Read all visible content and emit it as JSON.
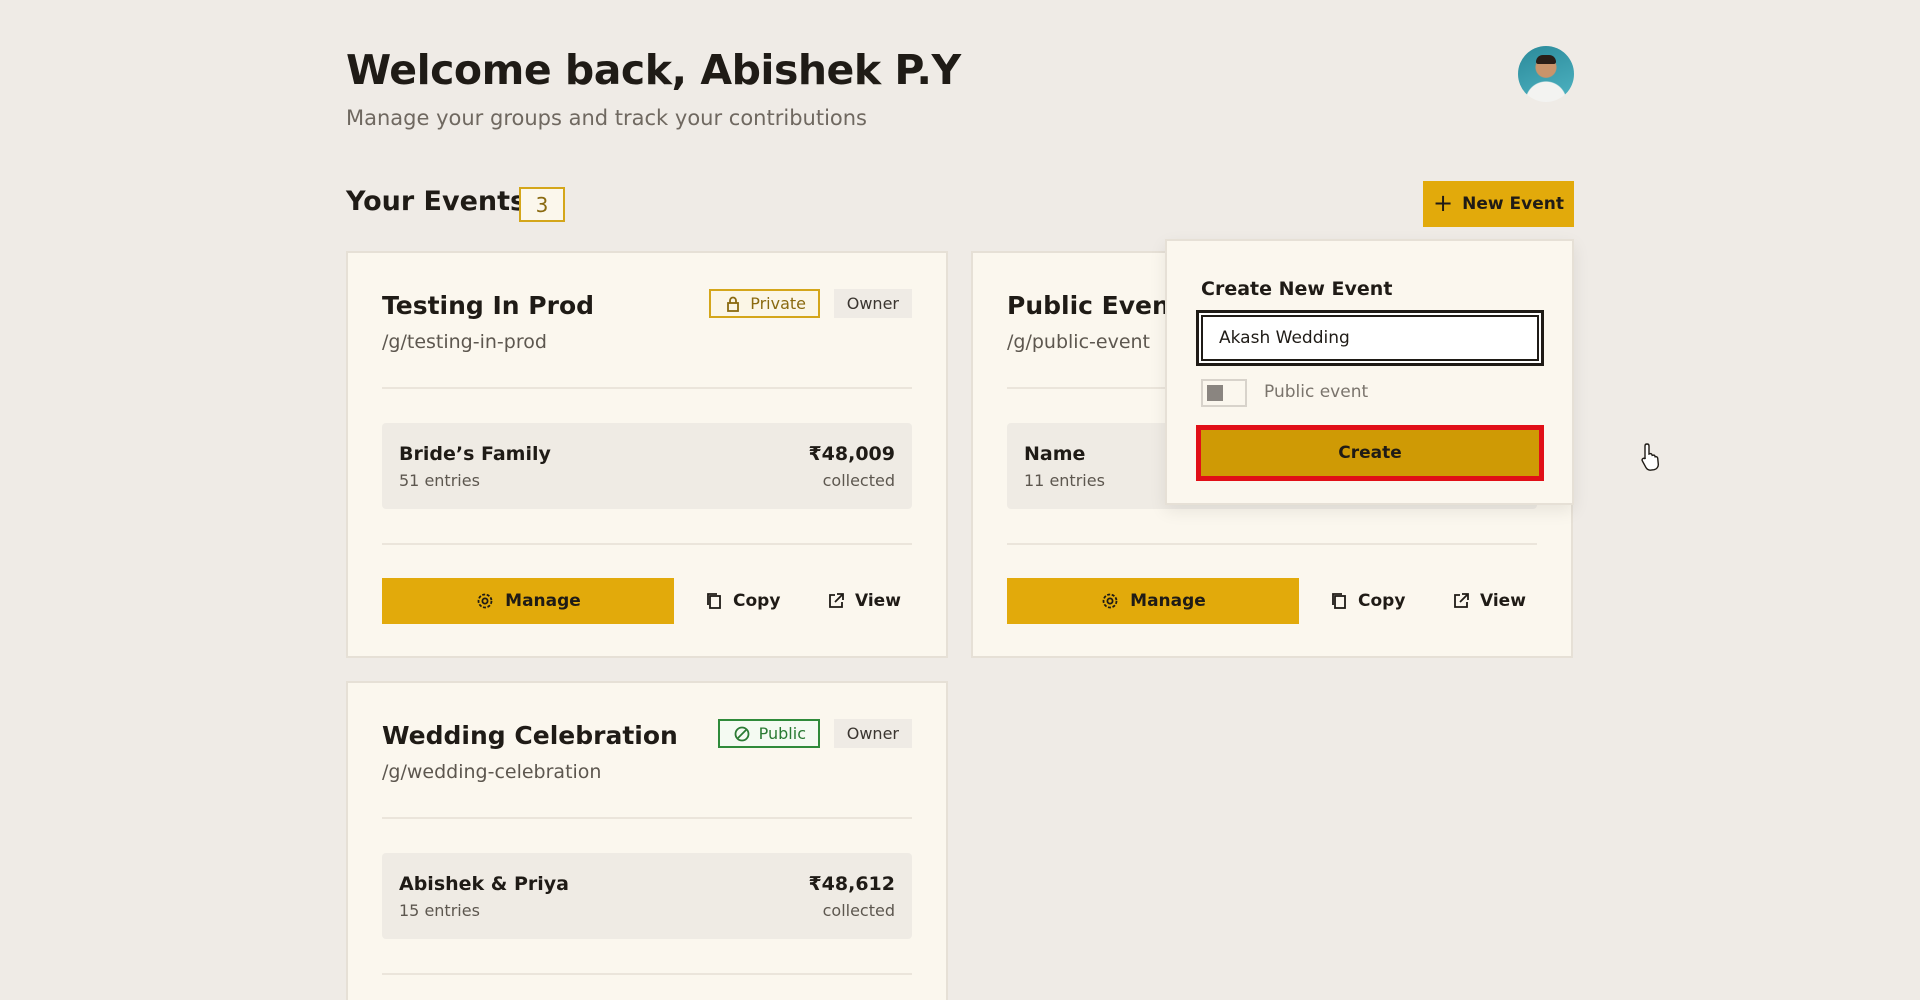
{
  "header": {
    "title": "Welcome back, Abishek P.Y",
    "subtitle": "Manage your groups and track your contributions"
  },
  "events_section": {
    "title": "Your Events",
    "count": "3",
    "new_event_label": "New Event"
  },
  "events": [
    {
      "title": "Testing In Prod",
      "slug": "/g/testing-in-prod",
      "visibility": "Private",
      "role": "Owner",
      "group": {
        "name": "Bride’s Family",
        "entries": "51 entries",
        "amount": "₹48,009",
        "collected": "collected"
      },
      "manage_label": "Manage",
      "copy_label": "Copy",
      "view_label": "View"
    },
    {
      "title": "Public Event",
      "slug": "/g/public-event",
      "group": {
        "name": "Name",
        "entries": "11 entries"
      },
      "manage_label": "Manage",
      "copy_label": "Copy",
      "view_label": "View"
    },
    {
      "title": "Wedding Celebration",
      "slug": "/g/wedding-celebration",
      "visibility": "Public",
      "role": "Owner",
      "group": {
        "name": "Abishek & Priya",
        "entries": "15 entries",
        "amount": "₹48,612",
        "collected": "collected"
      }
    }
  ],
  "create_popover": {
    "title": "Create New Event",
    "input_value": "Akash Wedding",
    "public_toggle_label": "Public event",
    "public_toggle_on": false,
    "create_label": "Create"
  },
  "colors": {
    "accent": "#e2aa0b",
    "background": "#efebe6",
    "card": "#fbf7ee",
    "highlight_border": "#e10f17"
  }
}
